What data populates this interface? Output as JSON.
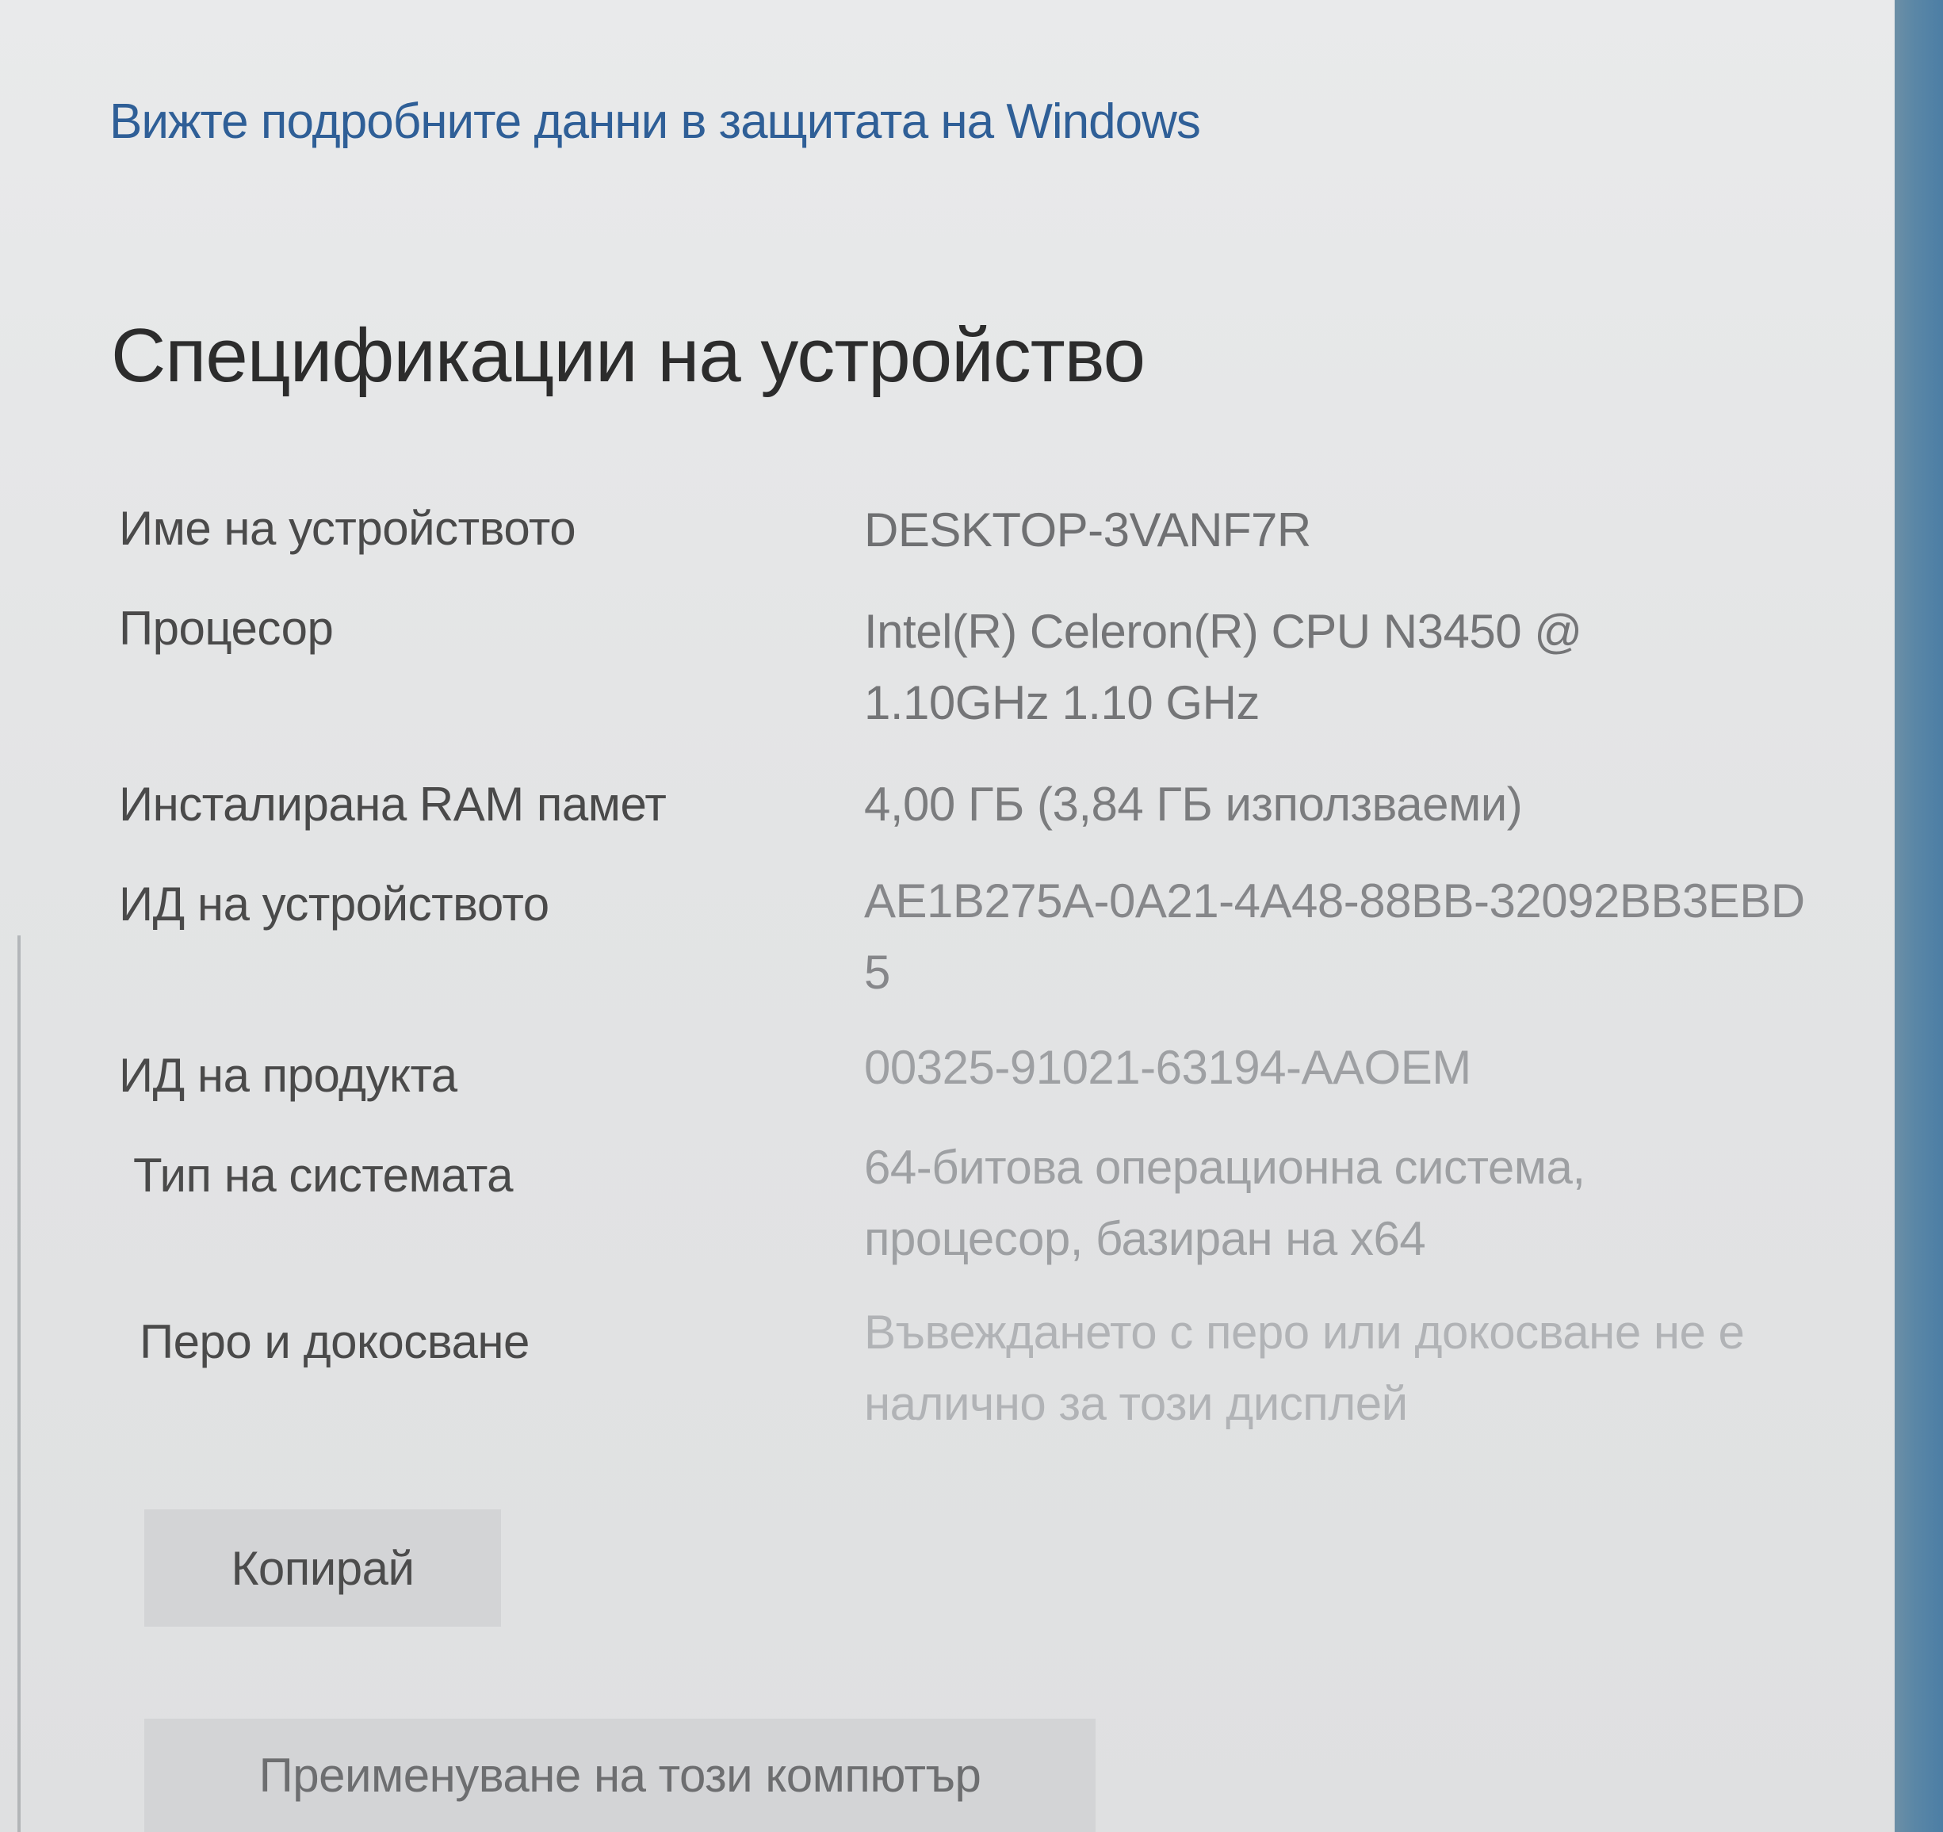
{
  "security_link": "Вижте подробните данни в защитата на Windows",
  "section_title": "Спецификации на устройство",
  "specs": [
    {
      "label": "Име на устройството",
      "value": "DESKTOP-3VANF7R"
    },
    {
      "label": "Процесор",
      "value": "Intel(R) Celeron(R) CPU N3450 @ 1.10GHz   1.10 GHz"
    },
    {
      "label": "Инсталирана RAM памет",
      "value": "4,00 ГБ (3,84 ГБ използваеми)"
    },
    {
      "label": "ИД на устройството",
      "value": "AE1B275A-0A21-4A48-88BB-32092BB3EBD5"
    },
    {
      "label": "ИД на продукта",
      "value": "00325-91021-63194-AAOEM"
    },
    {
      "label": "Тип на системата",
      "value": "64-битова операционна система, процесор, базиран на x64"
    },
    {
      "label": "Перо и докосване",
      "value": "Въвеждането с перо или докосване не е налично за този дисплей"
    }
  ],
  "buttons": {
    "copy": "Копирай",
    "rename": "Преименуване на този компютър"
  }
}
